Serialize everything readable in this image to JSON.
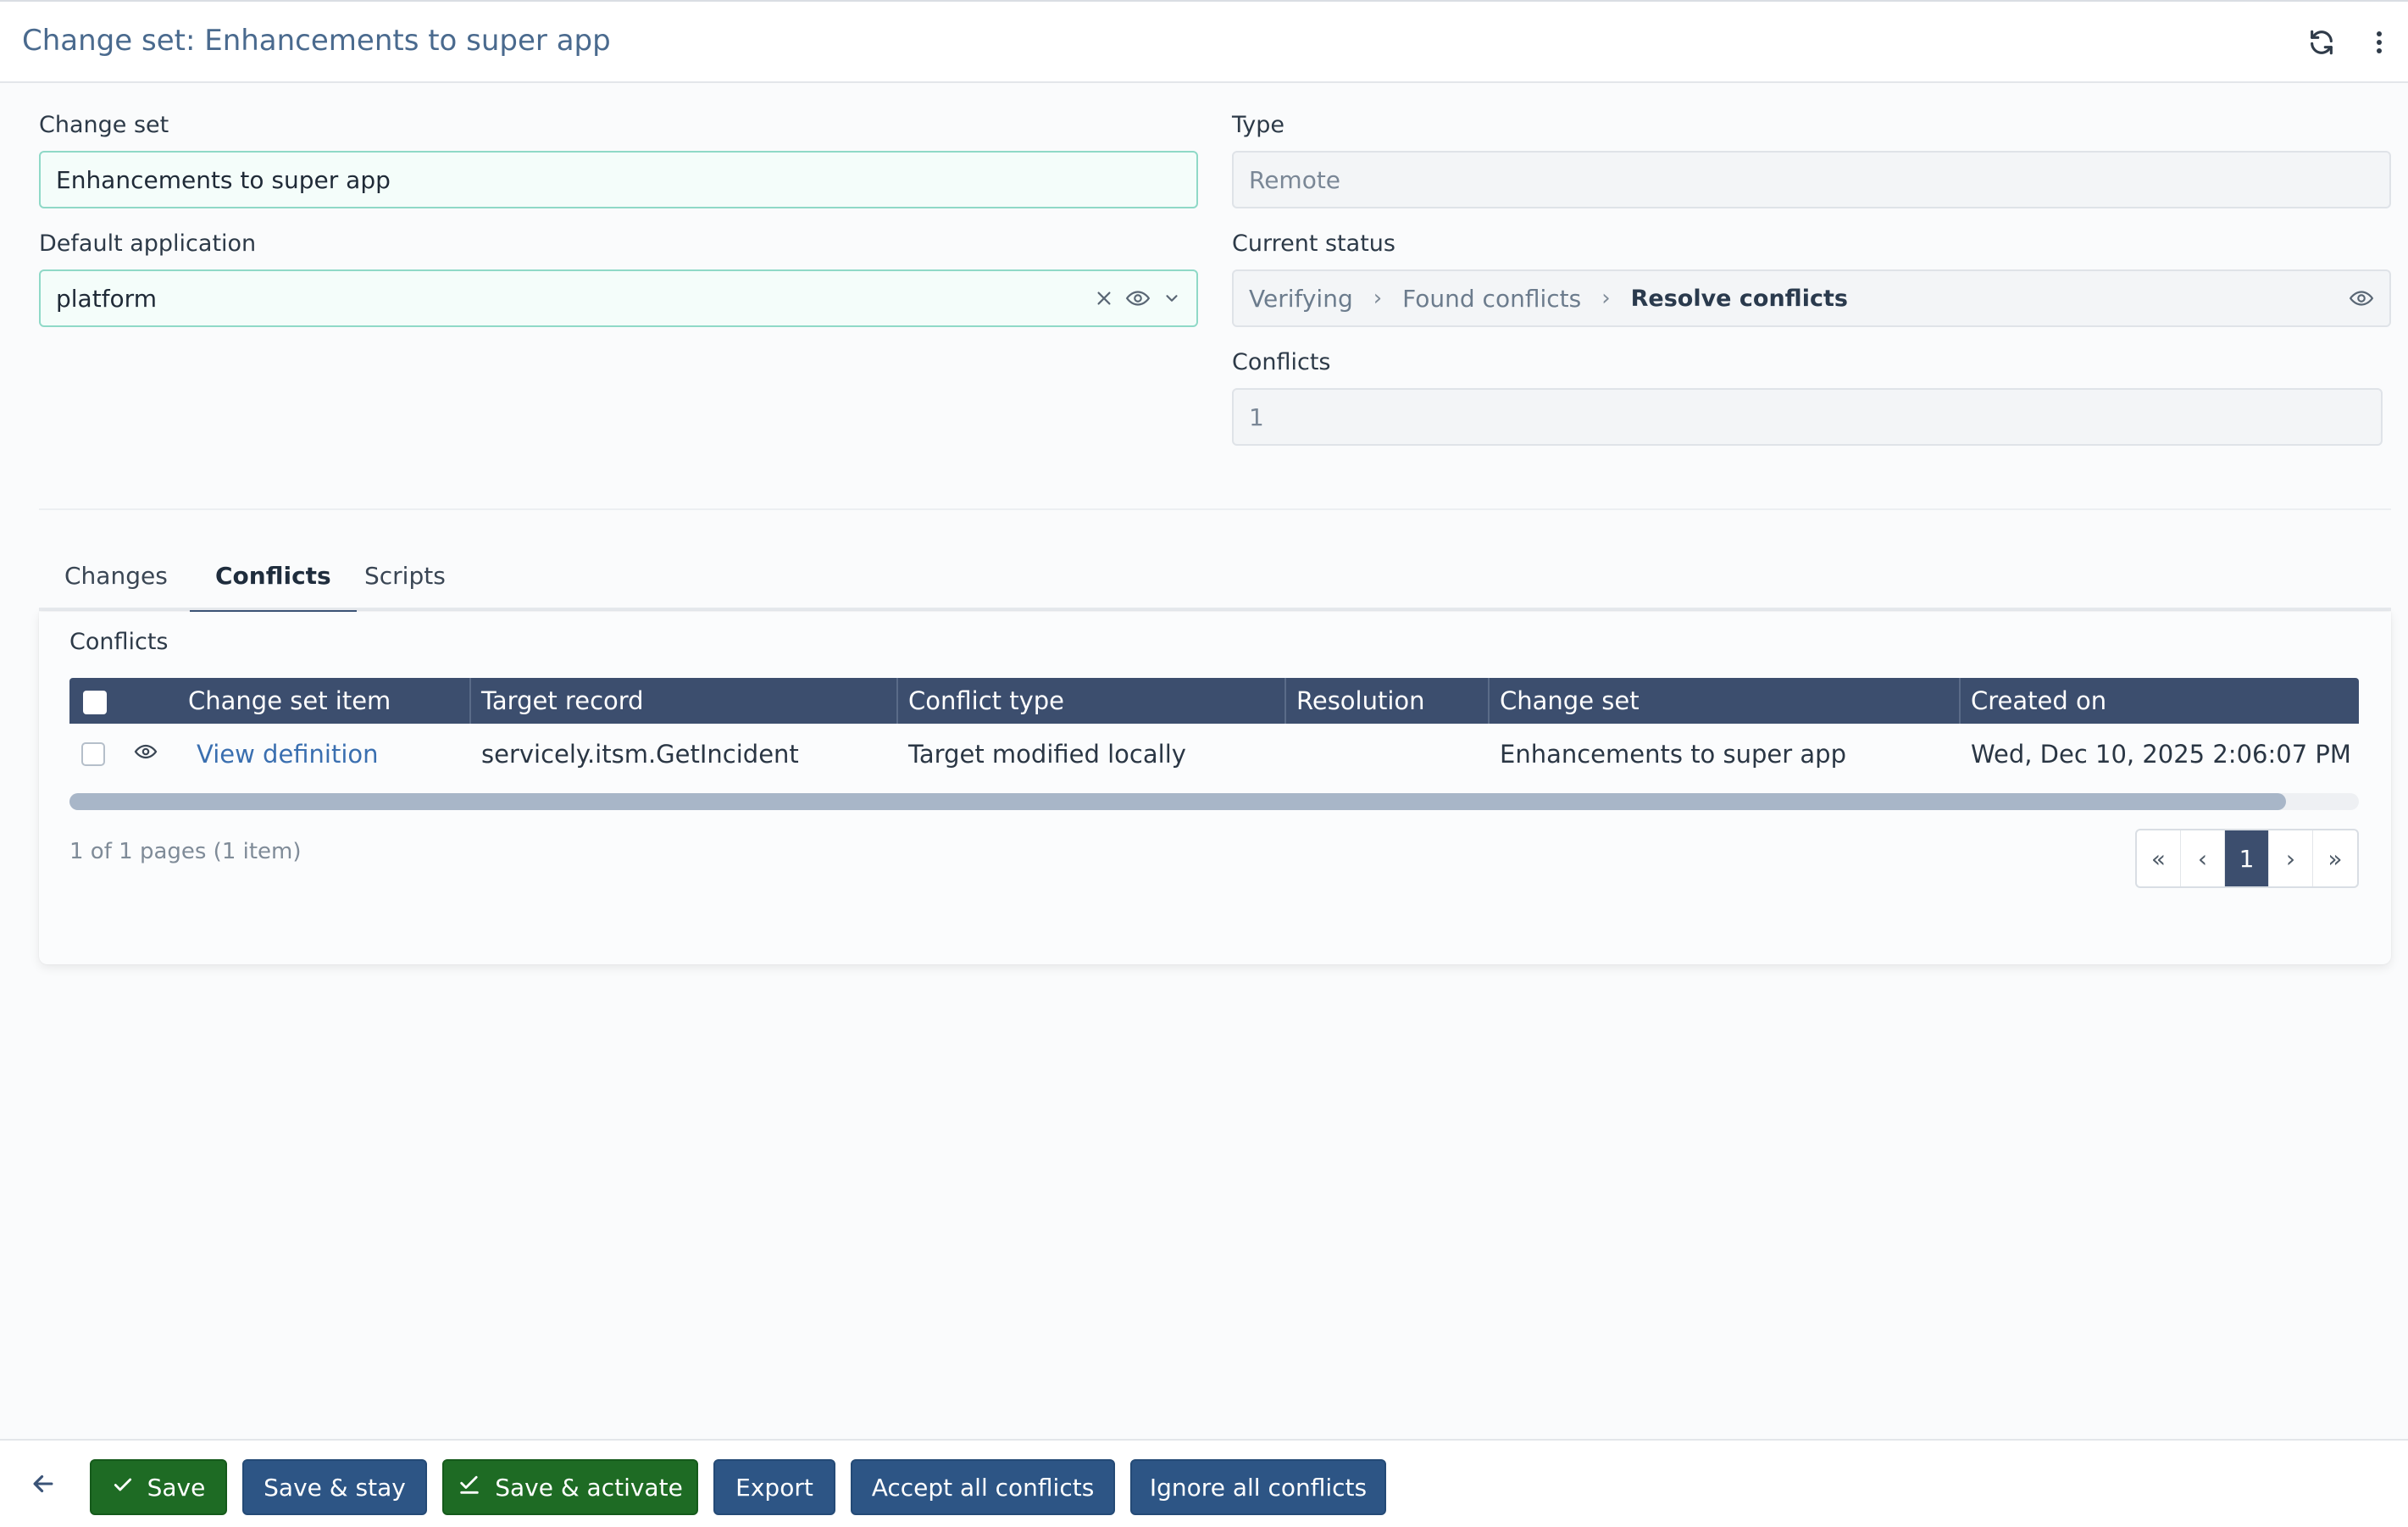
{
  "header": {
    "title": "Change set: Enhancements to super app",
    "refresh_icon": "refresh-icon",
    "menu_icon": "more-vertical-icon"
  },
  "form": {
    "change_set": {
      "label": "Change set",
      "value": "Enhancements to super app"
    },
    "type": {
      "label": "Type",
      "value": "Remote"
    },
    "default_application": {
      "label": "Default application",
      "value": "platform"
    },
    "current_status": {
      "label": "Current status",
      "steps": [
        "Verifying",
        "Found conflicts",
        "Resolve conflicts"
      ],
      "current_step": "Resolve conflicts"
    },
    "conflicts": {
      "label": "Conflicts",
      "value": "1"
    }
  },
  "tabs": [
    {
      "label": "Changes",
      "active": false
    },
    {
      "label": "Conflicts",
      "active": true
    },
    {
      "label": "Scripts",
      "active": false
    }
  ],
  "conflicts_panel": {
    "title": "Conflicts",
    "columns": [
      "Change set item",
      "Target record",
      "Conflict type",
      "Resolution",
      "Change set",
      "Created on"
    ],
    "rows": [
      {
        "change_set_item": "View definition",
        "target_record": "servicely.itsm.GetIncident",
        "conflict_type": "Target modified locally",
        "resolution": "",
        "change_set": "Enhancements to super app",
        "created_on": "Wed, Dec 10, 2025 2:06:07 PM"
      }
    ],
    "page_info": "1 of 1 pages (1 item)",
    "pager": {
      "first": "«",
      "prev": "‹",
      "current": "1",
      "next": "›",
      "last": "»"
    }
  },
  "footer": {
    "buttons": {
      "save": "Save",
      "save_stay": "Save & stay",
      "save_activate": "Save & activate",
      "export": "Export",
      "accept_all": "Accept all conflicts",
      "ignore_all": "Ignore all conflicts"
    }
  },
  "colors": {
    "accent_header": "#3c4e6e",
    "primary_blue": "#2d5585",
    "success_green": "#1e6b24",
    "link": "#3a6fb0"
  }
}
